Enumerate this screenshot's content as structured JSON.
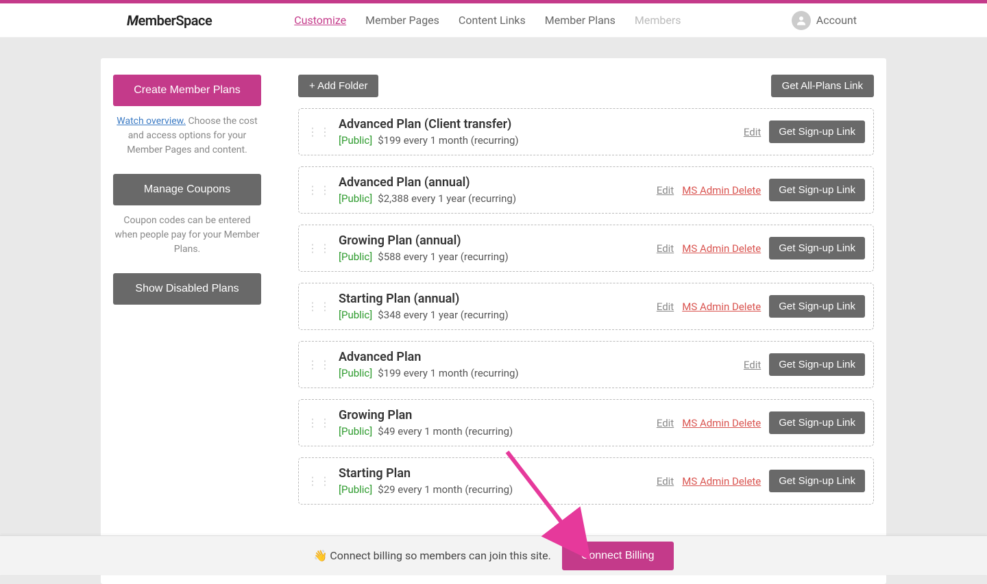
{
  "brand": "MemberSpace",
  "nav": {
    "items": [
      {
        "label": "Customize",
        "state": "active"
      },
      {
        "label": "Member Pages",
        "state": "normal"
      },
      {
        "label": "Content Links",
        "state": "normal"
      },
      {
        "label": "Member Plans",
        "state": "normal"
      },
      {
        "label": "Members",
        "state": "disabled"
      }
    ]
  },
  "account_label": "Account",
  "sidebar": {
    "create_plans_label": "Create Member Plans",
    "watch_overview_link": "Watch overview.",
    "create_plans_desc": " Choose the cost and access options for your Member Pages and content.",
    "manage_coupons_label": "Manage Coupons",
    "manage_coupons_desc": "Coupon codes can be entered when people pay for your Member Plans.",
    "show_disabled_label": "Show Disabled Plans"
  },
  "main": {
    "add_folder_label": "+ Add Folder",
    "get_all_plans_label": "Get All-Plans Link",
    "edit_label": "Edit",
    "delete_label": "MS Admin Delete",
    "signup_label": "Get Sign-up Link"
  },
  "plans": [
    {
      "title": "Advanced Plan (Client transfer)",
      "visibility": "[Public]",
      "price": "$199 every 1 month (recurring)",
      "has_delete": false
    },
    {
      "title": "Advanced Plan (annual)",
      "visibility": "[Public]",
      "price": "$2,388 every 1 year (recurring)",
      "has_delete": true
    },
    {
      "title": "Growing Plan (annual)",
      "visibility": "[Public]",
      "price": "$588 every 1 year (recurring)",
      "has_delete": true
    },
    {
      "title": "Starting Plan (annual)",
      "visibility": "[Public]",
      "price": "$348 every 1 year (recurring)",
      "has_delete": true
    },
    {
      "title": "Advanced Plan",
      "visibility": "[Public]",
      "price": "$199 every 1 month (recurring)",
      "has_delete": false
    },
    {
      "title": "Growing Plan",
      "visibility": "[Public]",
      "price": "$49 every 1 month (recurring)",
      "has_delete": true
    },
    {
      "title": "Starting Plan",
      "visibility": "[Public]",
      "price": "$29 every 1 month (recurring)",
      "has_delete": true
    }
  ],
  "footer": {
    "emoji": "👋",
    "text": "Connect billing so members can join this site.",
    "button": "Connect Billing"
  }
}
